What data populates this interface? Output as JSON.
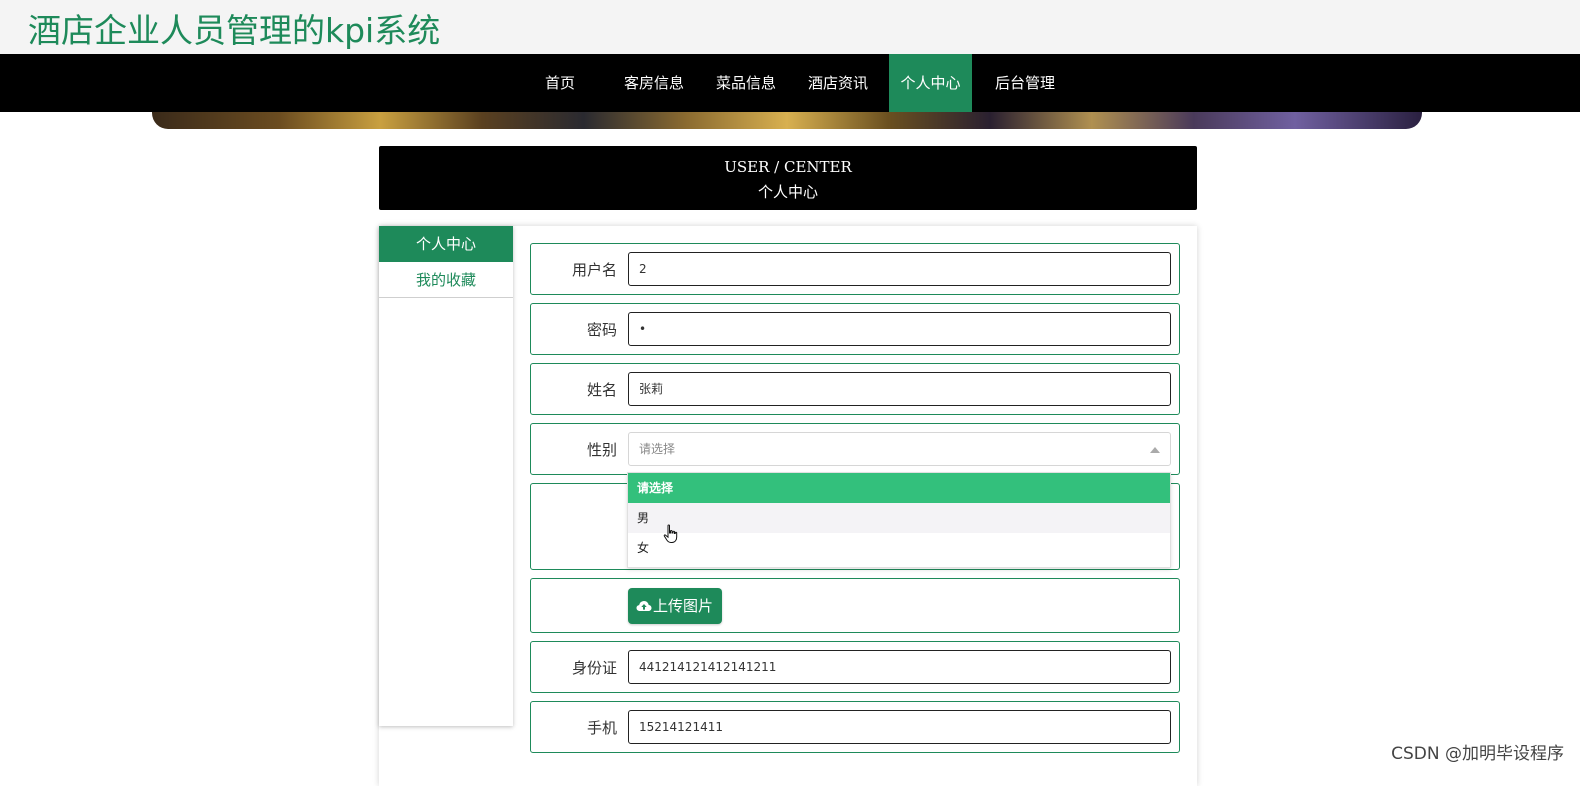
{
  "site": {
    "title": "酒店企业人员管理的kpi系统"
  },
  "nav": {
    "items": [
      {
        "label": "首页",
        "active": false
      },
      {
        "label": "客房信息",
        "active": false
      },
      {
        "label": "菜品信息",
        "active": false
      },
      {
        "label": "酒店资讯",
        "active": false
      },
      {
        "label": "个人中心",
        "active": true
      },
      {
        "label": "后台管理",
        "active": false
      }
    ]
  },
  "header": {
    "en": "USER / CENTER",
    "cn": "个人中心"
  },
  "sidebar": {
    "items": [
      {
        "label": "个人中心",
        "active": true
      },
      {
        "label": "我的收藏",
        "active": false
      }
    ]
  },
  "form": {
    "username": {
      "label": "用户名",
      "value": "2"
    },
    "password": {
      "label": "密码",
      "value": "•"
    },
    "name": {
      "label": "姓名",
      "value": "张莉"
    },
    "gender": {
      "label": "性别",
      "placeholder": "请选择",
      "options": [
        "请选择",
        "男",
        "女"
      ],
      "selected": "请选择",
      "hovered": "男"
    },
    "upload": {
      "label": "上传图片"
    },
    "idcard": {
      "label": "身份证",
      "value": "441214121412141211"
    },
    "phone": {
      "label": "手机",
      "value": "15214121411"
    }
  },
  "colors": {
    "brand": "#1e8a5a",
    "option_selected": "#33c07c",
    "nav_bg": "#000000"
  },
  "watermark": "CSDN @加明毕设程序"
}
